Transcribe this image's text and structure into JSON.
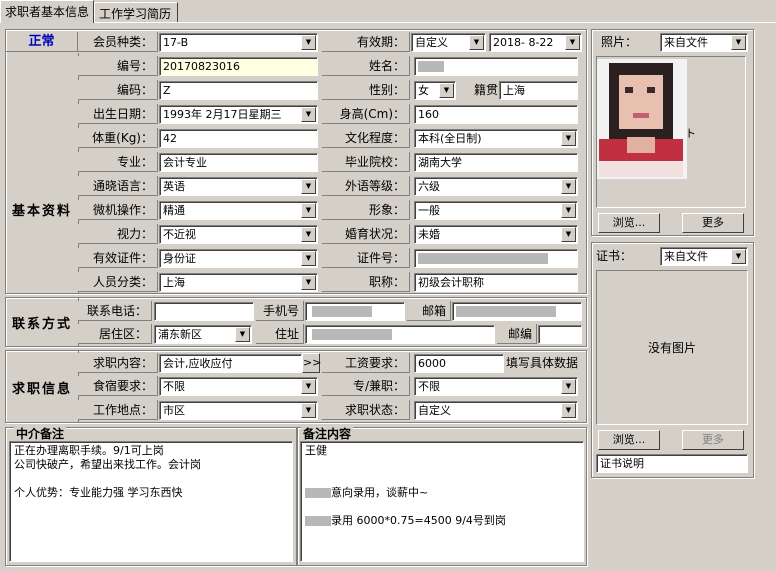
{
  "tabs": [
    "求职者基本信息",
    "工作学习简历"
  ],
  "header": {
    "status": "正常",
    "member_type_label": "会员种类：",
    "member_type": "17-B",
    "validity_label": "有效期：",
    "validity_mode": "自定义",
    "validity_date": "2018- 8-22"
  },
  "sections": {
    "basic": "基本资料",
    "contact": "联系方式",
    "job": "求职信息"
  },
  "basic": {
    "id_label": "编号：",
    "id": "20170823016",
    "name_label": "姓名：",
    "code_label": "编码：",
    "code": "Z",
    "gender_label": "性别：",
    "gender": "女",
    "native_label": "籍贯",
    "native": "上海",
    "birth_label": "出生日期：",
    "birth": "1993年 2月17日星期三",
    "height_label": "身高(Cm)：",
    "height": "160",
    "weight_label": "体重(Kg)：",
    "weight": "42",
    "edu_label": "文化程度：",
    "edu": "本科(全日制)",
    "major_label": "专业：",
    "major": "会计专业",
    "school_label": "毕业院校：",
    "school": "湖南大学",
    "lang_label": "通晓语言：",
    "lang": "英语",
    "lang_level_label": "外语等级：",
    "lang_level": "六级",
    "pc_label": "微机操作：",
    "pc": "精通",
    "image_label": "形象：",
    "image": "一般",
    "vision_label": "视力：",
    "vision": "不近视",
    "marital_label": "婚育状况：",
    "marital": "未婚",
    "cert_type_label": "有效证件：",
    "cert_type": "身份证",
    "cert_no_label": "证件号：",
    "category_label": "人员分类：",
    "category": "上海",
    "title_label": "职称：",
    "title": "初级会计职称"
  },
  "contact": {
    "phone_label": "联系电话：",
    "mobile_label": "手机号",
    "email_label": "邮箱",
    "district_label": "居住区：",
    "district": "浦东新区",
    "address_label": "住址",
    "zip_label": "邮编"
  },
  "job": {
    "content_label": "求职内容：",
    "content": "会计,应收应付",
    "more_btn": ">>",
    "salary_label": "工资要求：",
    "salary": "6000",
    "salary_hint": "填写具体数据",
    "board_label": "食宿要求：",
    "board": "不限",
    "fulltime_label": "专/兼职：",
    "fulltime": "不限",
    "location_label": "工作地点：",
    "location": "市区",
    "state_label": "求职状态：",
    "state": "自定义"
  },
  "notes": {
    "agency_title": "中介备注",
    "agency_text": "正在办理离职手续。9/1可上岗\n公司快破产，希望出来找工作。会计岗\n\n个人优势：专业能力强 学习东西快",
    "remark_title": "备注内容",
    "remark_line1": "王健",
    "remark_line2": "意向录用，谈薪中~",
    "remark_line3": "录用  6000*0.75=4500  9/4号到岗"
  },
  "photo": {
    "label": "照片：",
    "source": "来自文件",
    "browse": "浏览...",
    "more": "更多"
  },
  "cert": {
    "label": "证书：",
    "source": "来自文件",
    "empty": "没有图片",
    "browse": "浏览...",
    "more": "更多",
    "desc": "证书说明"
  }
}
